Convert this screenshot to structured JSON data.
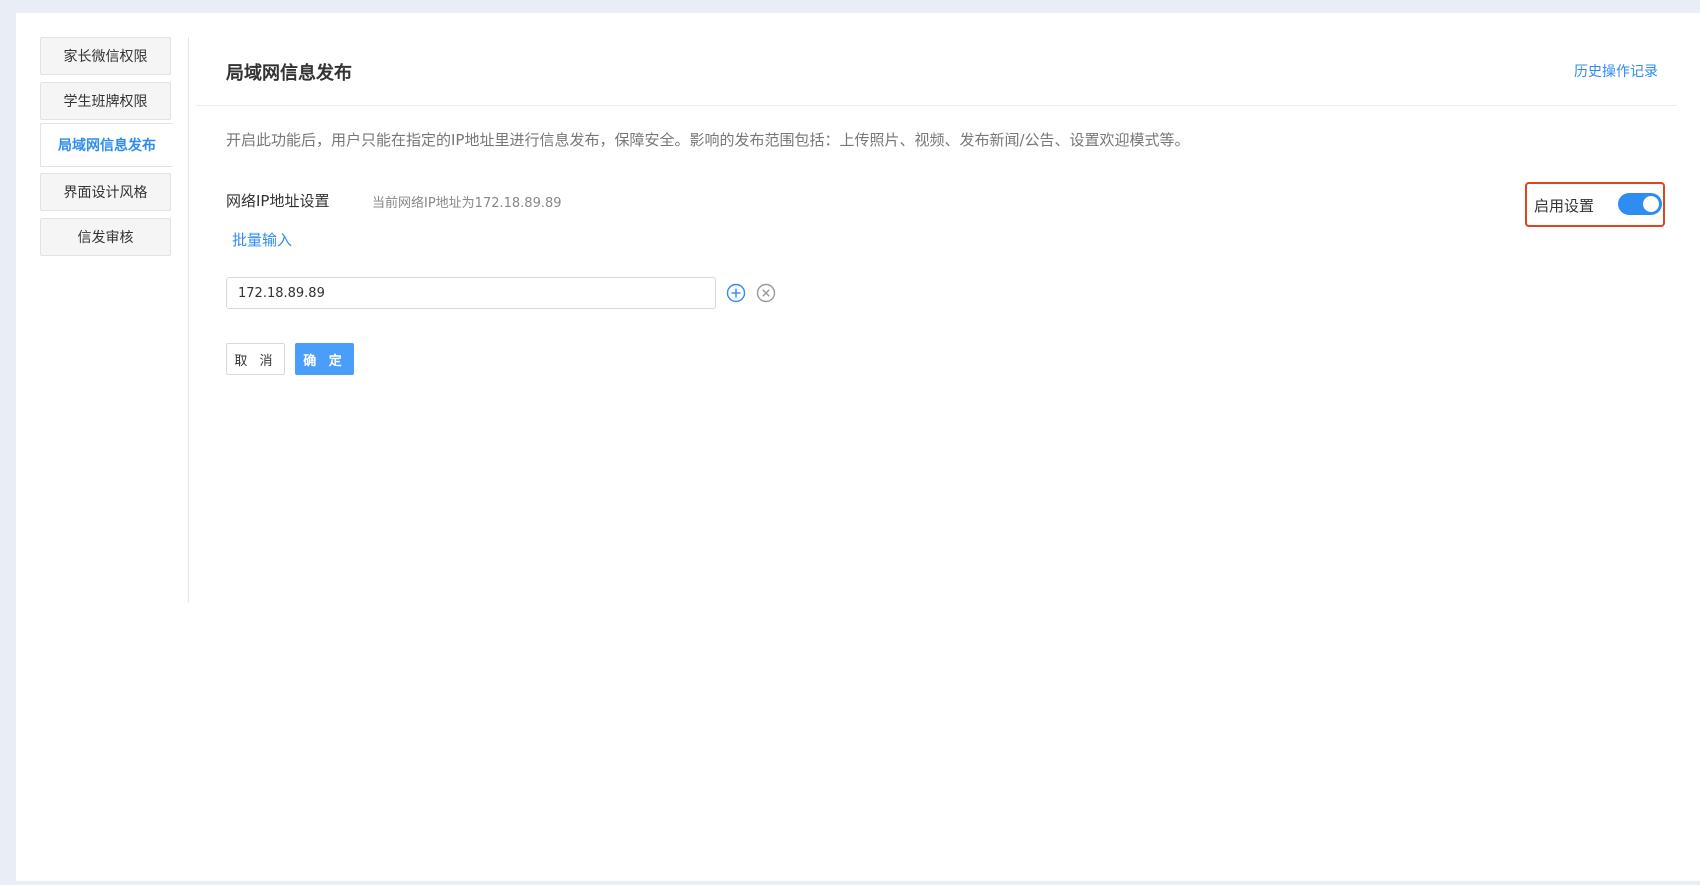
{
  "sidebar": {
    "items": [
      {
        "label": "家长微信权限",
        "active": false
      },
      {
        "label": "学生班牌权限",
        "active": false
      },
      {
        "label": "局域网信息发布",
        "active": true
      },
      {
        "label": "界面设计风格",
        "active": false
      },
      {
        "label": "信发审核",
        "active": false
      }
    ]
  },
  "header": {
    "title": "局域网信息发布",
    "history_link": "历史操作记录"
  },
  "description": "开启此功能后，用户只能在指定的IP地址里进行信息发布，保障安全。影响的发布范围包括：上传照片、视频、发布新闻/公告、设置欢迎模式等。",
  "ip_settings": {
    "label": "网络IP地址设置",
    "current_ip_text": "当前网络IP地址为172.18.89.89",
    "batch_input_link": "批量输入",
    "ip_value": "172.18.89.89",
    "add_icon": "plus-circle-icon",
    "remove_icon": "close-circle-icon"
  },
  "enable": {
    "label": "启用设置",
    "on": true
  },
  "actions": {
    "cancel_label": "取 消",
    "ok_label": "确 定"
  },
  "colors": {
    "accent": "#2f8cf0",
    "highlight_border": "#e0441c",
    "page_background": "#e9edf5"
  }
}
